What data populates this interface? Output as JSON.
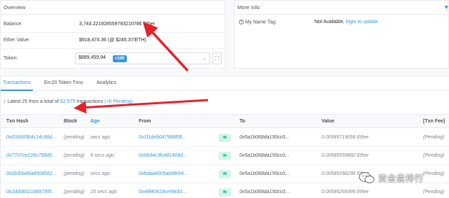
{
  "overview": {
    "title": "Overview",
    "balance_label": "Balance:",
    "balance_value": "3,743.221928559793210786 Ether",
    "ether_value_label": "Ether Value:",
    "ether_value": "$918,474.36 (@ $245.37/ETH)",
    "token_label": "Token:",
    "token_value": "$889,459.94",
    "token_badge": ">100"
  },
  "more_info": {
    "title": "More Info",
    "name_tag_label": "My Name Tag:",
    "name_tag_value": "Not Available,",
    "name_tag_link": "login to update"
  },
  "tabs": [
    {
      "label": "Transactions"
    },
    {
      "label": "Erc20 Token Txns"
    },
    {
      "label": "Analytics"
    }
  ],
  "summary": {
    "prefix": "Latest 25 from a total of",
    "count": "62,575",
    "mid": "transactions",
    "pending": "(+6 Pending)"
  },
  "table": {
    "headers": [
      "Txn Hash",
      "Block",
      "Age",
      "From",
      "To",
      "Value",
      "[Txn Fee]"
    ],
    "rows": [
      {
        "hash": "0x03468364c14c96d...",
        "block": "(pending)",
        "age": "secs ago",
        "from": "0x1f1deb047968f06...",
        "dir": "IN",
        "to": "0x5a1b068da150cc0...",
        "value": "0.00585719056 Ether",
        "fee": "(Pending)"
      },
      {
        "hash": "0x7707ce226c758d0...",
        "block": "(pending)",
        "age": "6 secs ago",
        "from": "0x96d4c3fc481409d...",
        "dir": "IN",
        "to": "0x5a1b068da150cc0...",
        "value": "0.00585559892 Ether",
        "fee": "(Pending)"
      },
      {
        "hash": "0x0b30a46a8908562...",
        "block": "(pending)",
        "age": "secs ago",
        "from": "0xbdaa4905ab8fe64...",
        "dir": "IN",
        "to": "0x5a1b068da150cc0...",
        "value": "0.00585268296 Ether",
        "fee": "(Pending)"
      },
      {
        "hash": "0x2dd08321889795f...",
        "block": "(pending)",
        "age": "15 secs ago",
        "from": "0x44f40419ce99cb1...",
        "dir": "IN",
        "to": "0x5a1b068da150cc0...",
        "value": "0.00585269395 Ether",
        "fee": "(Pending)"
      }
    ]
  },
  "watermark": {
    "text": "资金盘排行"
  },
  "colors": {
    "accent": "#3498db",
    "annotation_arrow": "#e8202a",
    "in_badge": "#00a186"
  }
}
